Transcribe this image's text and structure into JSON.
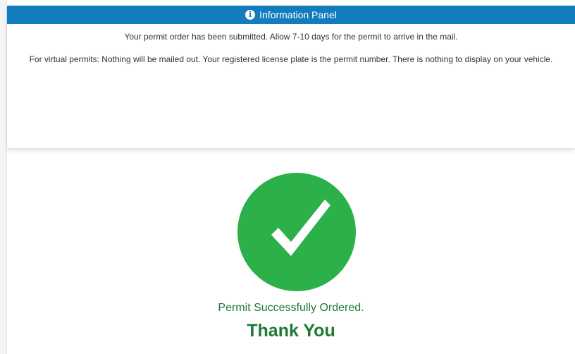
{
  "info_panel": {
    "title": "Information Panel",
    "icon": "info-circle-icon",
    "header_color": "#137cbd",
    "messages": [
      "Your permit order has been submitted. Allow 7-10 days for the permit to arrive in the mail.",
      "For virtual permits: Nothing will be mailed out. Your registered license plate is the permit number. There is nothing to display on your vehicle."
    ]
  },
  "success": {
    "icon": "checkmark-circle-icon",
    "icon_color": "#2bb04a",
    "message": "Permit Successfully Ordered.",
    "thanks": "Thank You",
    "text_color": "#1e7a35"
  }
}
